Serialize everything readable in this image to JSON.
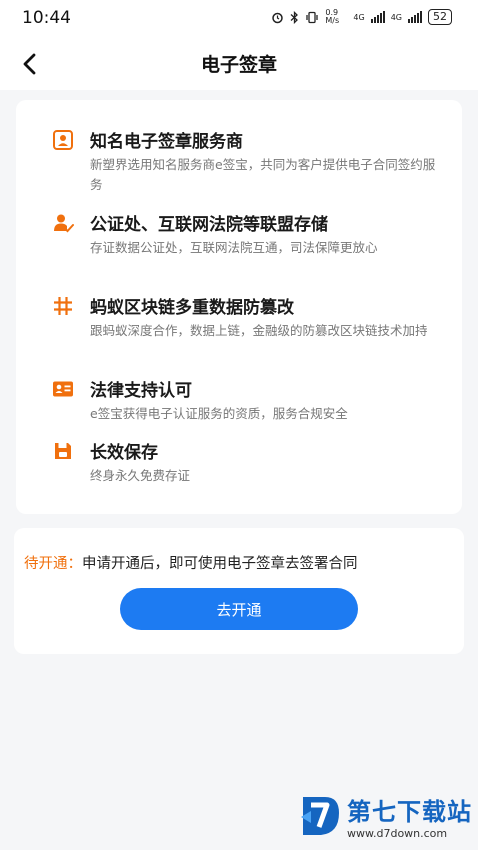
{
  "status_bar": {
    "time": "10:44",
    "net_speed": "0.9 M/s",
    "sim1": "4G",
    "sim2": "4G",
    "battery": "52"
  },
  "header": {
    "title": "电子签章"
  },
  "features": [
    {
      "icon": "id-card-icon",
      "title": "知名电子签章服务商",
      "desc": "新塑界选用知名服务商e签宝，共同为客户提供电子合同签约服务"
    },
    {
      "icon": "user-check-icon",
      "title": "公证处、互联网法院等联盟存储",
      "desc": "存证数据公证处，互联网法院互通，司法保障更放心"
    },
    {
      "icon": "hash-icon",
      "title": "蚂蚁区块链多重数据防篡改",
      "desc": "跟蚂蚁深度合作，数据上链，金融级的防篡改区块链技术加持"
    },
    {
      "icon": "license-card-icon",
      "title": "法律支持认可",
      "desc": "e签宝获得电子认证服务的资质，服务合规安全"
    },
    {
      "icon": "save-icon",
      "title": "长效保存",
      "desc": "终身永久免费存证"
    }
  ],
  "activation": {
    "status_label": "待开通：",
    "status_text": "申请开通后，即可使用电子签章去签署合同",
    "button_label": "去开通"
  },
  "watermark": {
    "name": "第七下载站",
    "url": "www.d7down.com"
  },
  "colors": {
    "accent_orange": "#f0700e",
    "primary_blue": "#1d7bf2",
    "watermark_blue": "#1565c0"
  }
}
